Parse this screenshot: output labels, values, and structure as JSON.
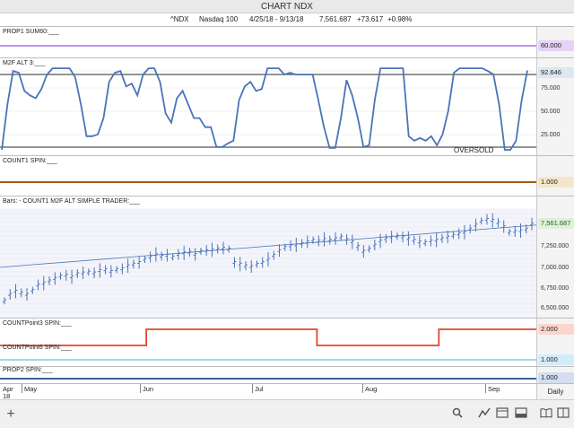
{
  "window": {
    "title": "CHART NDX"
  },
  "header": {
    "symbol": "^NDX",
    "name": "Nasdaq 100",
    "range": "4/25/18 - 9/13/18",
    "last": "7,561.687",
    "change": "+73.617",
    "pct": "+0.98%"
  },
  "colors": {
    "purple": "#b36be6",
    "blue": "#4a74b8",
    "brown": "#a45a18",
    "red": "#e2472d",
    "lightblue": "#82c6ee",
    "navy": "#1f4e8c"
  },
  "panels": {
    "prop1": {
      "label": "PROP1 SUM60:___",
      "value": "60.000"
    },
    "m2f": {
      "label": "M2F ALT 3:___",
      "value": "92.646",
      "ticks": [
        "75.000",
        "50.000",
        "25.000"
      ],
      "note": "OVERSOLD"
    },
    "count1": {
      "label": "COUNT1 SPIN:___",
      "value": "1.000"
    },
    "bars": {
      "label": "Bars: -   COUNT1 M2F ALT SIMPLE TRADER:___",
      "value": "7,561.687",
      "ticks": [
        "7,250.000",
        "7,000.000",
        "6,750.000",
        "6,500.000"
      ]
    },
    "countp3": {
      "label": "COUNTPoint3 SPIN:___",
      "value": "2.000"
    },
    "countp6": {
      "label": "COUNTPoint6 SPIN:___",
      "value": "1.000"
    },
    "prop2": {
      "label": "PROP2 SPIN:___",
      "value": "1.000"
    }
  },
  "xaxis": {
    "months": [
      {
        "t": "Apr",
        "sub": "18"
      },
      {
        "t": "May"
      },
      {
        "t": "Jun"
      },
      {
        "t": "Jul"
      },
      {
        "t": "Aug"
      },
      {
        "t": "Sep"
      }
    ],
    "period": "Daily"
  },
  "toolbar": {
    "icons": [
      "plus-icon",
      "search-icon",
      "line-chart-icon",
      "layout-icon",
      "panel-icon",
      "book-icon",
      "columns-icon"
    ]
  },
  "chart_data": [
    {
      "type": "line",
      "title": "PROP1 SUM60",
      "values": [
        60,
        60
      ],
      "ylim": [
        0,
        100
      ]
    },
    {
      "type": "line",
      "title": "M2F ALT 3",
      "ylim": [
        0,
        100
      ],
      "overbought": 92.646,
      "oversold": 10,
      "values": [
        5,
        55,
        92,
        90,
        70,
        65,
        62,
        72,
        88,
        95,
        95,
        95,
        95,
        85,
        55,
        20,
        20,
        22,
        40,
        80,
        90,
        92,
        75,
        78,
        65,
        88,
        95,
        95,
        80,
        45,
        35,
        62,
        70,
        55,
        40,
        40,
        30,
        30,
        8,
        8,
        12,
        15,
        60,
        75,
        80,
        70,
        72,
        95,
        95,
        95,
        88,
        90,
        88,
        88,
        88,
        88,
        60,
        30,
        7,
        7,
        40,
        82,
        65,
        40,
        8,
        10,
        60,
        95,
        95,
        95,
        95,
        95,
        20,
        15,
        18,
        15,
        20,
        10,
        22,
        48,
        90,
        95,
        95,
        95,
        95,
        95,
        92,
        88,
        55,
        5,
        5,
        15,
        60,
        92.6
      ]
    },
    {
      "type": "line",
      "title": "COUNT1 SPIN",
      "values": [
        1,
        1
      ]
    },
    {
      "type": "bar",
      "title": "Bars",
      "ylim": [
        6400,
        7750
      ],
      "last": 7561.687,
      "values": [
        6600,
        6680,
        6720,
        6700,
        6680,
        6730,
        6800,
        6820,
        6850,
        6880,
        6910,
        6920,
        6900,
        6940,
        6950,
        6960,
        6950,
        6980,
        6990,
        6970,
        6990,
        7000,
        7040,
        7060,
        7080,
        7120,
        7150,
        7180,
        7160,
        7170,
        7150,
        7180,
        7200,
        7210,
        7180,
        7220,
        7230,
        7240,
        7250,
        7260,
        7250,
        7080,
        7060,
        7040,
        7030,
        7060,
        7080,
        7120,
        7170,
        7230,
        7270,
        7290,
        7300,
        7320,
        7340,
        7360,
        7350,
        7370,
        7360,
        7380,
        7400,
        7370,
        7340,
        7280,
        7220,
        7250,
        7300,
        7350,
        7380,
        7400,
        7410,
        7400,
        7380,
        7360,
        7340,
        7330,
        7350,
        7360,
        7380,
        7400,
        7420,
        7440,
        7460,
        7500,
        7550,
        7600,
        7620,
        7610,
        7580,
        7530,
        7460,
        7470,
        7480,
        7500,
        7561.687
      ],
      "trend": [
        7020,
        7550
      ]
    },
    {
      "type": "line",
      "title": "COUNTPoint3 SPIN",
      "values": [
        1,
        1,
        1,
        1,
        1,
        1,
        2,
        2,
        2,
        2,
        2,
        2,
        2,
        1,
        1,
        1,
        1,
        1,
        2,
        2,
        2,
        2
      ]
    },
    {
      "type": "line",
      "title": "COUNTPoint6 SPIN",
      "values": [
        1,
        1
      ]
    },
    {
      "type": "line",
      "title": "PROP2 SPIN",
      "values": [
        1,
        1
      ]
    }
  ]
}
